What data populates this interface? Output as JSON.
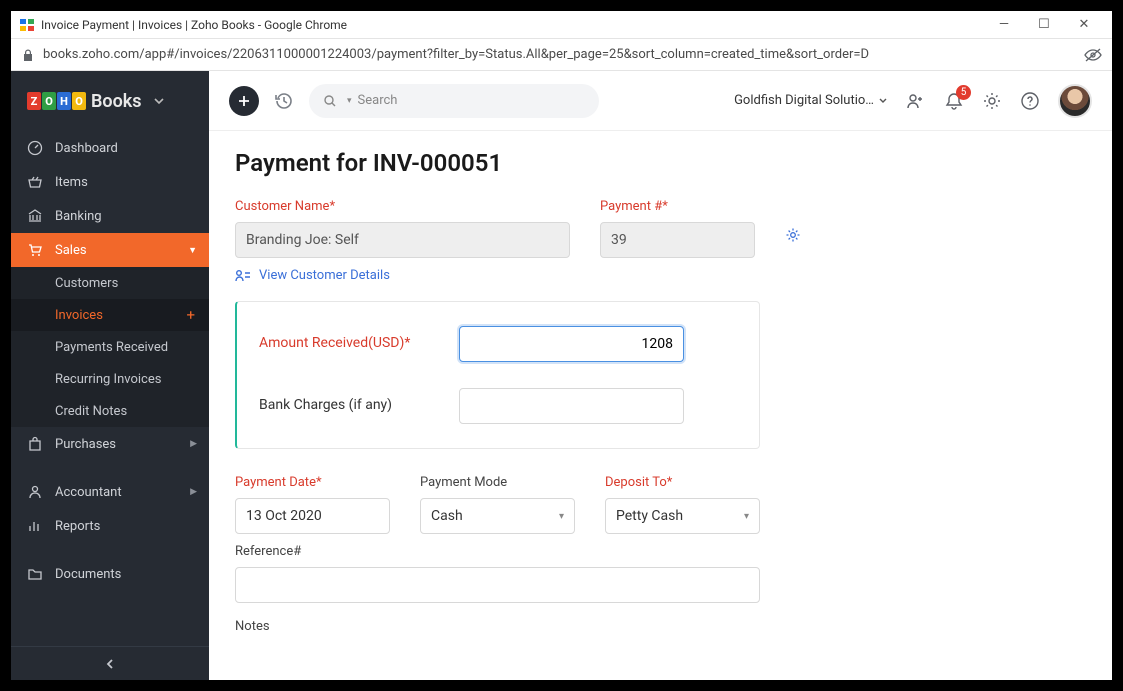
{
  "browser": {
    "title": "Invoice Payment | Invoices | Zoho Books - Google Chrome",
    "url": "books.zoho.com/app#/invoices/2206311000001224003/payment?filter_by=Status.All&per_page=25&sort_column=created_time&sort_order=D"
  },
  "brand": {
    "text": "Books"
  },
  "sidebar": {
    "items": [
      {
        "label": "Dashboard"
      },
      {
        "label": "Items"
      },
      {
        "label": "Banking"
      },
      {
        "label": "Sales"
      },
      {
        "label": "Purchases"
      },
      {
        "label": "Accountant"
      },
      {
        "label": "Reports"
      },
      {
        "label": "Documents"
      }
    ],
    "sales_sub": [
      {
        "label": "Customers"
      },
      {
        "label": "Invoices"
      },
      {
        "label": "Payments Received"
      },
      {
        "label": "Recurring Invoices"
      },
      {
        "label": "Credit Notes"
      }
    ]
  },
  "topbar": {
    "search_placeholder": "Search",
    "org": "Goldfish Digital Solutio…",
    "notif_count": "5"
  },
  "page": {
    "title": "Payment for INV-000051",
    "customer_label": "Customer Name*",
    "customer_value": "Branding Joe: Self",
    "payment_num_label": "Payment #*",
    "payment_num_value": "39",
    "view_details": "View Customer Details",
    "amount_label": "Amount Received(USD)*",
    "amount_value": "1208",
    "bank_charges_label": "Bank Charges (if any)",
    "bank_charges_value": "",
    "payment_date_label": "Payment Date*",
    "payment_date_value": "13 Oct 2020",
    "payment_mode_label": "Payment Mode",
    "payment_mode_value": "Cash",
    "deposit_to_label": "Deposit To*",
    "deposit_to_value": "Petty Cash",
    "reference_label": "Reference#",
    "reference_value": "",
    "notes_label": "Notes"
  }
}
